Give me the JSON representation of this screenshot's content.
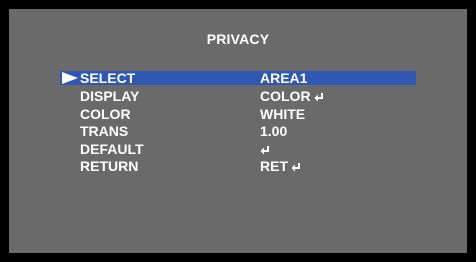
{
  "menu": {
    "title": "PRIVACY",
    "items": [
      {
        "label": "SELECT",
        "value": "AREA1",
        "enter_icon": false,
        "selected": true
      },
      {
        "label": "DISPLAY",
        "value": "COLOR",
        "enter_icon": true,
        "selected": false
      },
      {
        "label": "COLOR",
        "value": "WHITE",
        "enter_icon": false,
        "selected": false
      },
      {
        "label": "TRANS",
        "value": "1.00",
        "enter_icon": false,
        "selected": false
      },
      {
        "label": "DEFAULT",
        "value": "",
        "enter_icon": true,
        "selected": false
      },
      {
        "label": "RETURN",
        "value": "RET",
        "enter_icon": true,
        "selected": false
      }
    ]
  },
  "icons": {
    "cursor": "right-triangle-cursor-icon",
    "enter": "enter-return-icon"
  },
  "colors": {
    "background": "#6a6a6a",
    "frame": "#000000",
    "highlight": "#2f57b3",
    "text": "#ffffff"
  }
}
